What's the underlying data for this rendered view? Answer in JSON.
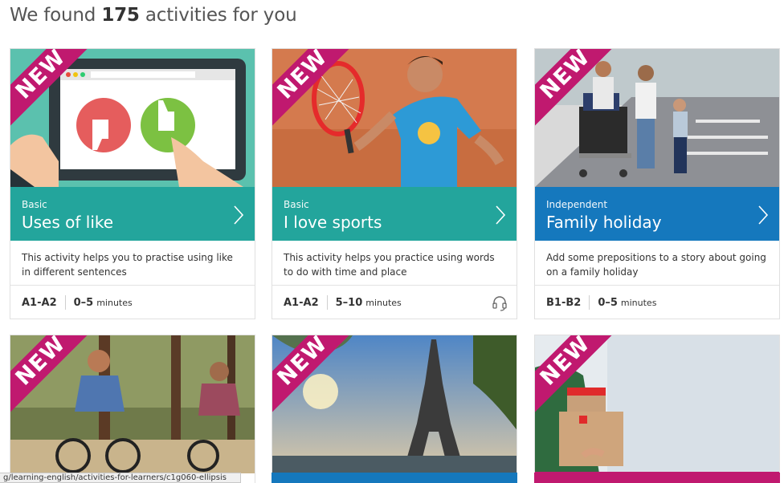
{
  "results": {
    "prefix": "We found",
    "count": "175",
    "suffix": "activities for you"
  },
  "ribbon_label": "NEW",
  "cards": [
    {
      "level": "Basic",
      "title": "Uses of like",
      "description": "This activity helps you to practise using like in different sentences",
      "cefr": "A1-A2",
      "duration": "0–5",
      "unit": "minutes",
      "band_color": "#23a59c",
      "has_audio": false
    },
    {
      "level": "Basic",
      "title": "I love sports",
      "description": "This activity helps you practice using words to do with time and place",
      "cefr": "A1-A2",
      "duration": "5–10",
      "unit": "minutes",
      "band_color": "#23a59c",
      "has_audio": true
    },
    {
      "level": "Independent",
      "title": "Family holiday",
      "description": "Add some prepositions to a story about going on a family holiday",
      "cefr": "B1-B2",
      "duration": "0–5",
      "unit": "minutes",
      "band_color": "#1578bd",
      "has_audio": false
    }
  ],
  "status_bar": {
    "url": "g/learning-english/activities-for-learners/c1g060-ellipsis"
  },
  "colors": {
    "ribbon": "#c0196f",
    "teal": "#23a59c",
    "blue": "#1578bd"
  }
}
